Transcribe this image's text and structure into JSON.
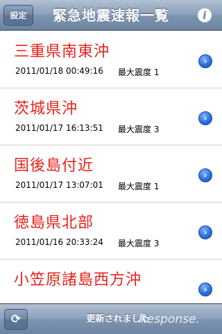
{
  "header": {
    "settings_label": "設定",
    "title": "緊急地震速報一覧",
    "info_icon": "i"
  },
  "list": {
    "items": [
      {
        "location": "三重県南東沖",
        "datetime": "2011/01/18 00:49:16",
        "magnitude": "最大震度 1"
      },
      {
        "location": "茨城県沖",
        "datetime": "2011/01/17 16:13:51",
        "magnitude": "最大震度 3"
      },
      {
        "location": "国後島付近",
        "datetime": "2011/01/17 13:07:01",
        "magnitude": "最大震度 1"
      },
      {
        "location": "徳島県北部",
        "datetime": "2011/01/16 20:33:24",
        "magnitude": "最大震度 3"
      },
      {
        "location": "小笠原諸島西方沖",
        "datetime": "",
        "magnitude": ""
      }
    ]
  },
  "toolbar": {
    "refresh_icon": "refresh-icon",
    "status": "更新されました"
  },
  "watermark": "Response.",
  "colors": {
    "accent": "#6d84a2",
    "title_red": "#e8211b",
    "disclosure_blue": "#2e6fdc"
  }
}
